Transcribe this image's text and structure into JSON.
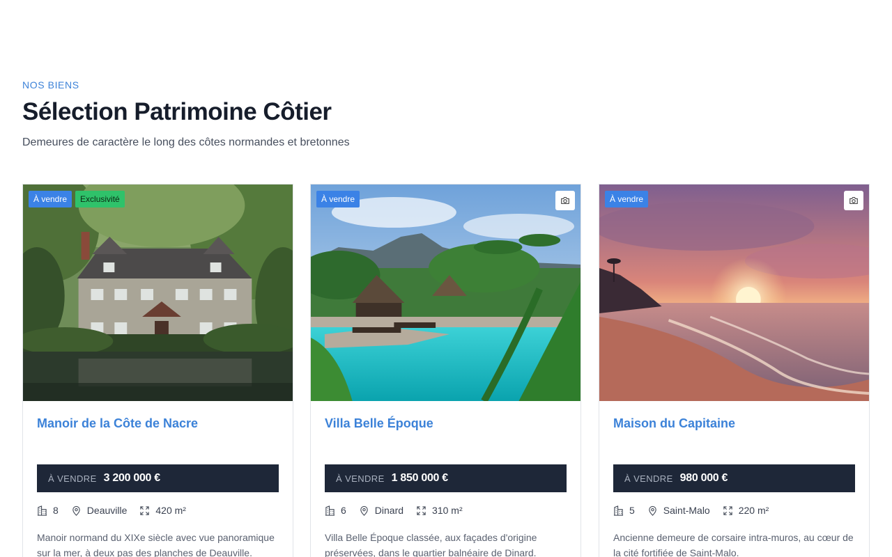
{
  "section": {
    "eyebrow": "NOS BIENS",
    "title": "Sélection Patrimoine Côtier",
    "subtitle": "Demeures de caractère le long des côtes normandes et bretonnes"
  },
  "cards": [
    {
      "name": "Manoir de la Côte de Nacre",
      "badges": [
        "À vendre",
        "Exclusivité"
      ],
      "price_label": "À VENDRE",
      "price": "3 200 000 €",
      "rooms": "8",
      "city": "Deauville",
      "area": "420 m²",
      "description": "Manoir normand du XIXe siècle avec vue panoramique sur la mer, à deux pas des planches de Deauville.",
      "image": "stone-manor-by-lake"
    },
    {
      "name": "Villa Belle Époque",
      "badges": [
        "À vendre"
      ],
      "price_label": "À VENDRE",
      "price": "1 850 000 €",
      "rooms": "6",
      "city": "Dinard",
      "area": "310 m²",
      "description": "Villa Belle Époque classée, aux façades d'origine préservées, dans le quartier balnéaire de Dinard.",
      "image": "tropical-pool-resort"
    },
    {
      "name": "Maison du Capitaine",
      "badges": [
        "À vendre"
      ],
      "price_label": "À VENDRE",
      "price": "980 000 €",
      "rooms": "5",
      "city": "Saint-Malo",
      "area": "220 m²",
      "description": "Ancienne demeure de corsaire intra-muros, au cœur de la cité fortifiée de Saint-Malo.",
      "image": "sunset-beach"
    }
  ],
  "icons": {
    "rooms": "building-icon",
    "location": "map-pin-icon",
    "area": "expand-icon",
    "camera": "camera-icon"
  },
  "colors": {
    "accent": "#3b82e6",
    "exclusive": "#2fc26a",
    "pricebar": "#1e2738"
  }
}
